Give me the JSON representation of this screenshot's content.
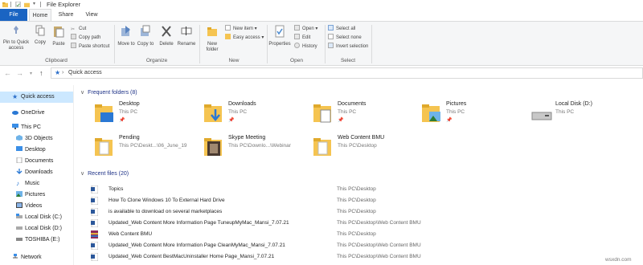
{
  "window": {
    "title": "File Explorer"
  },
  "tabs": [
    "File",
    "Home",
    "Share",
    "View"
  ],
  "ribbon": {
    "clipboard": {
      "pin_label": "Pin to Quick access",
      "copy_label": "Copy",
      "paste_label": "Paste",
      "cut_label": "Cut",
      "copy_path_label": "Copy path",
      "paste_shortcut_label": "Paste shortcut",
      "group_label": "Clipboard"
    },
    "organize": {
      "move_to_label": "Move to",
      "copy_to_label": "Copy to",
      "delete_label": "Delete",
      "rename_label": "Rename",
      "group_label": "Organize"
    },
    "new": {
      "new_folder_label": "New folder",
      "new_item_label": "New item",
      "easy_access_label": "Easy access",
      "group_label": "New"
    },
    "open": {
      "properties_label": "Properties",
      "open_label": "Open",
      "edit_label": "Edit",
      "history_label": "History",
      "group_label": "Open"
    },
    "select": {
      "select_all_label": "Select all",
      "select_none_label": "Select none",
      "invert_label": "Invert selection",
      "group_label": "Select"
    }
  },
  "address": {
    "path": "Quick access"
  },
  "sidebar": {
    "items": [
      {
        "label": "Quick access",
        "icon": "star-icon"
      },
      {
        "label": "OneDrive",
        "icon": "cloud-icon"
      },
      {
        "label": "This PC",
        "icon": "computer-icon"
      },
      {
        "label": "3D Objects",
        "icon": "cube-icon"
      },
      {
        "label": "Desktop",
        "icon": "desktop-icon"
      },
      {
        "label": "Documents",
        "icon": "documents-icon"
      },
      {
        "label": "Downloads",
        "icon": "download-icon"
      },
      {
        "label": "Music",
        "icon": "music-icon"
      },
      {
        "label": "Pictures",
        "icon": "pictures-icon"
      },
      {
        "label": "Videos",
        "icon": "videos-icon"
      },
      {
        "label": "Local Disk (C:)",
        "icon": "disk-icon"
      },
      {
        "label": "Local Disk (D:)",
        "icon": "disk-icon"
      },
      {
        "label": "TOSHIBA (E:)",
        "icon": "usb-drive-icon"
      },
      {
        "label": "Network",
        "icon": "network-icon"
      }
    ]
  },
  "frequent": {
    "header": "Frequent folders (8)",
    "folders": [
      {
        "name": "Desktop",
        "location": "This PC",
        "pinned": true
      },
      {
        "name": "Downloads",
        "location": "This PC",
        "pinned": true
      },
      {
        "name": "Documents",
        "location": "This PC",
        "pinned": true
      },
      {
        "name": "Pictures",
        "location": "This PC",
        "pinned": true
      },
      {
        "name": "Local Disk (D:)",
        "location": "This PC",
        "pinned": false
      },
      {
        "name": "Pending",
        "location": "This PC\\Deskt...\\06_June_19",
        "pinned": false
      },
      {
        "name": "Skype Meeting",
        "location": "This PC\\Downlo...\\Webinar",
        "pinned": false
      },
      {
        "name": "Web Content BMU",
        "location": "This PC\\Desktop",
        "pinned": false
      }
    ]
  },
  "recent": {
    "header": "Recent files (20)",
    "files": [
      {
        "name": "Topics",
        "location": "This PC\\Desktop",
        "type": "word"
      },
      {
        "name": "How To Clone Windows 10 To External Hard Drive",
        "location": "This PC\\Desktop",
        "type": "word"
      },
      {
        "name": "is available to download on several marketplaces",
        "location": "This PC\\Desktop",
        "type": "word"
      },
      {
        "name": "Updated_Web Content More Information Page TuneupMyMac_Mansi_7.07.21",
        "location": "This PC\\Desktop\\Web Content BMU",
        "type": "word"
      },
      {
        "name": "Web Content BMU",
        "location": "This PC\\Desktop",
        "type": "archive"
      },
      {
        "name": "Updated_Web Content More Information Page CleanMyMac_Mansi_7.07.21",
        "location": "This PC\\Desktop\\Web Content BMU",
        "type": "word"
      },
      {
        "name": "Updated_Web Content BestMacUninstaller Home Page_Mansi_7.07.21",
        "location": "This PC\\Desktop\\Web Content BMU",
        "type": "word"
      }
    ]
  },
  "watermark": "wsxdn.com",
  "colors": {
    "accent": "#1a64c2",
    "folder": "#f5c451",
    "selected": "#cce8ff",
    "header": "#1e3287"
  }
}
